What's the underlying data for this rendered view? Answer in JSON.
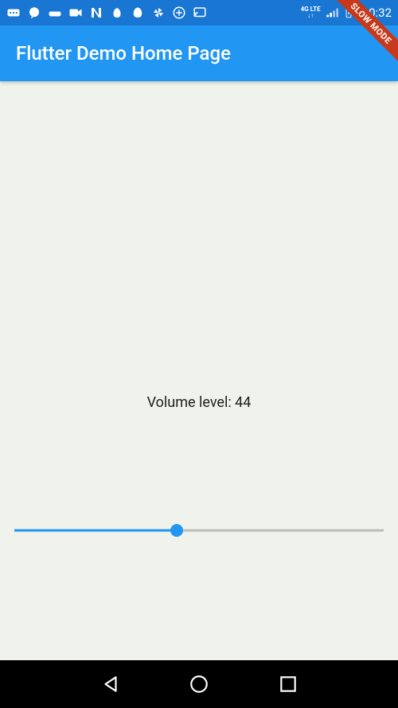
{
  "status_bar": {
    "time": "10:32",
    "lte_label": "4G LTE"
  },
  "app_bar": {
    "title": "Flutter Demo Home Page"
  },
  "content": {
    "volume_label_prefix": "Volume level: ",
    "volume_value": 44,
    "slider_min": 0,
    "slider_max": 100
  },
  "debug_banner": {
    "label": "SLOW MODE"
  }
}
